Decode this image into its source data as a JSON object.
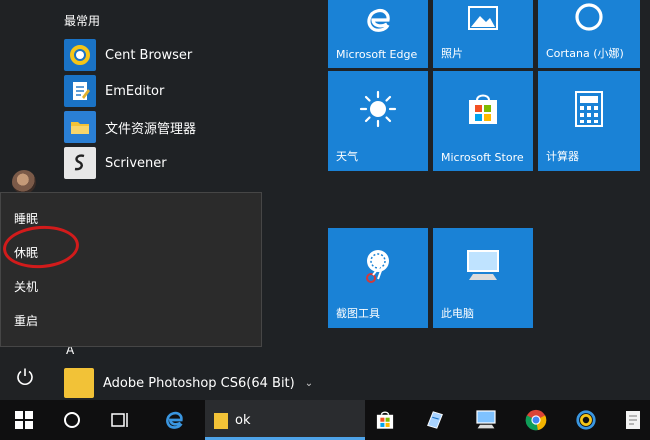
{
  "start_menu": {
    "section_title": "最常用",
    "apps": [
      {
        "label": "Cent Browser",
        "icon": "cent-browser-icon"
      },
      {
        "label": "EmEditor",
        "icon": "emeditor-icon"
      },
      {
        "label": "文件资源管理器",
        "icon": "file-explorer-icon"
      },
      {
        "label": "Scrivener",
        "icon": "scrivener-icon"
      }
    ],
    "letter_header": "A",
    "photoshop": {
      "label": "Adobe Photoshop CS6(64 Bit)",
      "expand": "⌄"
    }
  },
  "power_menu": {
    "items": [
      "睡眠",
      "休眠",
      "关机",
      "重启"
    ],
    "highlight_color": "#d21b1b"
  },
  "tiles": [
    {
      "label": "Microsoft Edge",
      "icon": "edge-icon"
    },
    {
      "label": "照片",
      "icon": "photos-icon"
    },
    {
      "label": "Cortana (小娜)",
      "icon": "cortana-icon"
    },
    {
      "label": "天气",
      "icon": "weather-sun-icon"
    },
    {
      "label": "Microsoft Store",
      "icon": "store-icon"
    },
    {
      "label": "计算器",
      "icon": "calculator-icon"
    },
    {
      "label": "截图工具",
      "icon": "snipping-tool-icon"
    },
    {
      "label": "此电脑",
      "icon": "this-pc-icon"
    }
  ],
  "taskbar": {
    "open_window_label": "ok"
  },
  "colors": {
    "tile_blue": "#1a82d6",
    "background": "#1f2225",
    "taskbar": "#0f0f10",
    "accent_line": "#4ea3e8"
  }
}
